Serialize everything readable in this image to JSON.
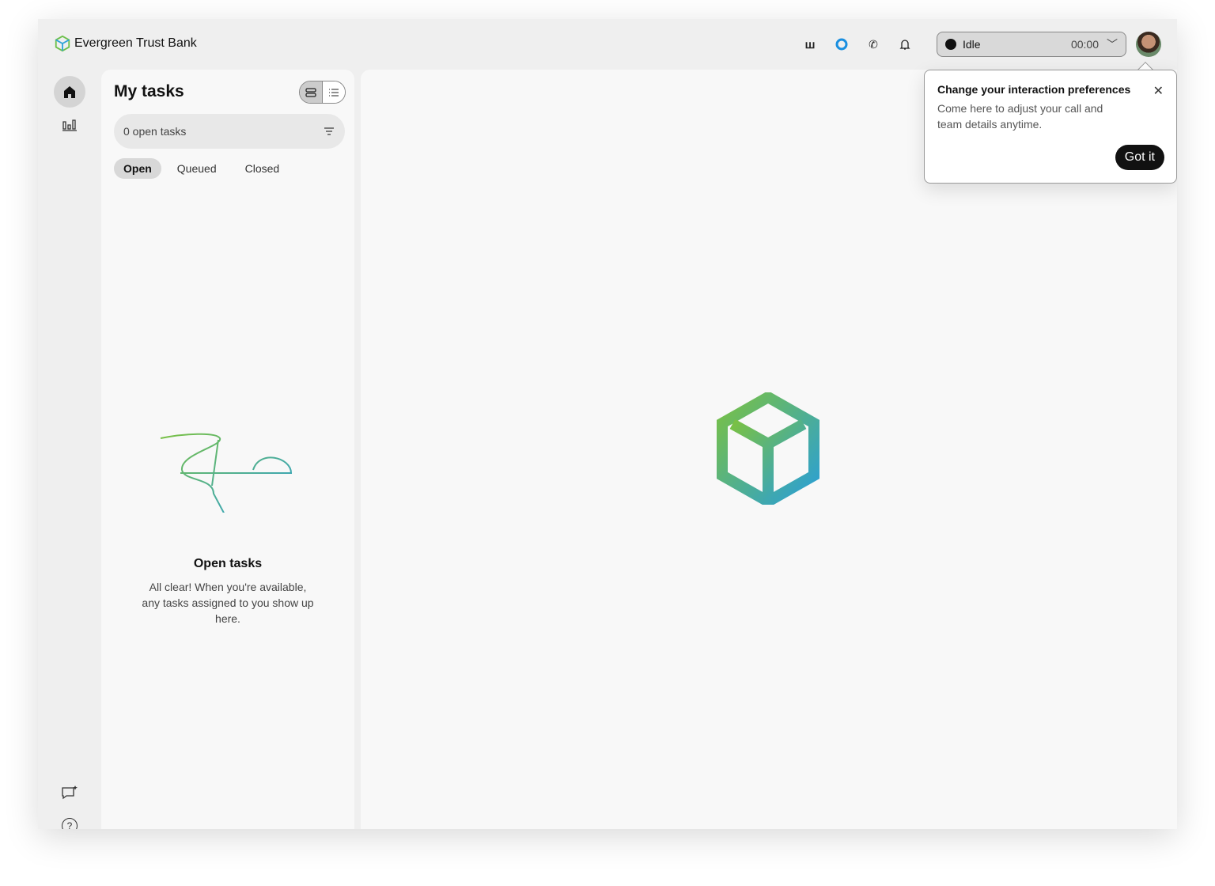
{
  "header": {
    "brand": "Evergreen Trust Bank",
    "status": "Idle",
    "timer": "00:00"
  },
  "tasks": {
    "title": "My tasks",
    "search_placeholder": "0 open tasks",
    "tabs": [
      "Open",
      "Queued",
      "Closed"
    ],
    "empty_title": "Open tasks",
    "empty_text": "All clear! When you're available, any tasks assigned to you show up here."
  },
  "popover": {
    "title": "Change your interaction preferences",
    "text": "Come here to adjust your call and team details anytime.",
    "button": "Got it"
  }
}
